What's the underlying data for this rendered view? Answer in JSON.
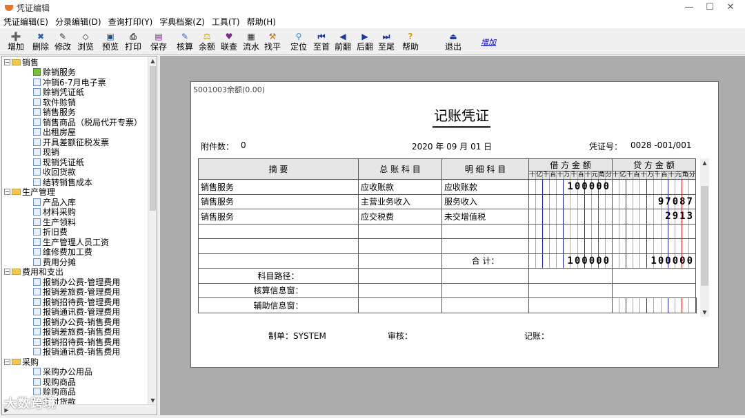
{
  "window": {
    "title": "凭证编辑",
    "controls": [
      "—",
      "☐",
      "✕"
    ]
  },
  "menu": [
    "凭证编辑(E)",
    "分录编辑(D)",
    "查询打印(Y)",
    "字典档案(Z)",
    "工具(T)",
    "帮助(H)"
  ],
  "toolbar": [
    {
      "label": "增加",
      "icon": "add-icon",
      "glyph": "➕",
      "color": "#2a5db0"
    },
    {
      "label": "删除",
      "icon": "delete-icon",
      "glyph": "✖",
      "color": "#2a5db0"
    },
    {
      "label": "修改",
      "icon": "edit-icon",
      "glyph": "✎",
      "color": "#333"
    },
    {
      "label": "浏览",
      "icon": "browse-icon",
      "glyph": "◇",
      "color": "#333"
    },
    {
      "label": "预览",
      "icon": "preview-icon",
      "glyph": "▣",
      "color": "#225588"
    },
    {
      "label": "打印",
      "icon": "print-icon",
      "glyph": "⎙",
      "color": "#333"
    },
    {
      "label": "保存",
      "icon": "save-icon",
      "glyph": "▤",
      "color": "#7a2a8a"
    },
    {
      "label": "核算",
      "icon": "calc-icon",
      "glyph": "✎",
      "color": "#3366cc"
    },
    {
      "label": "余额",
      "icon": "balance-icon",
      "glyph": "⚖",
      "color": "#c0a000"
    },
    {
      "label": "联查",
      "icon": "linked-query-icon",
      "glyph": "♥",
      "color": "#7a2a8a"
    },
    {
      "label": "流水",
      "icon": "journal-icon",
      "glyph": "▦",
      "color": "#333"
    },
    {
      "label": "找平",
      "icon": "level-icon",
      "glyph": "⚒",
      "color": "#c07000"
    },
    {
      "label": "定位",
      "icon": "locate-icon",
      "glyph": "⚲",
      "color": "#3388cc"
    },
    {
      "label": "至首",
      "icon": "first-icon",
      "glyph": "⏮",
      "color": "#1a3aa0"
    },
    {
      "label": "前翻",
      "icon": "prev-icon",
      "glyph": "◀",
      "color": "#1a3aa0"
    },
    {
      "label": "后翻",
      "icon": "next-icon",
      "glyph": "▶",
      "color": "#1a3aa0"
    },
    {
      "label": "至尾",
      "icon": "last-icon",
      "glyph": "⏭",
      "color": "#1a3aa0"
    },
    {
      "label": "帮助",
      "icon": "help-icon",
      "glyph": "?",
      "color": "#d4a000"
    },
    {
      "label": "退出",
      "icon": "exit-icon",
      "glyph": "⏏",
      "color": "#1a3aa0"
    }
  ],
  "toolbar_link": "增加",
  "tree": [
    {
      "level": 0,
      "type": "folder",
      "label": "销售"
    },
    {
      "level": 1,
      "type": "leaf",
      "label": "赊销服务",
      "selected": true
    },
    {
      "level": 1,
      "type": "leaf",
      "label": "冲销6-7月电子票"
    },
    {
      "level": 1,
      "type": "leaf",
      "label": "赊销凭证纸"
    },
    {
      "level": 1,
      "type": "leaf",
      "label": "软件赊销"
    },
    {
      "level": 1,
      "type": "leaf",
      "label": "销售服务"
    },
    {
      "level": 1,
      "type": "leaf",
      "label": "销售商品（税局代开专票）"
    },
    {
      "level": 1,
      "type": "leaf",
      "label": "出租房屋"
    },
    {
      "level": 1,
      "type": "leaf",
      "label": "开具差额征税发票"
    },
    {
      "level": 1,
      "type": "leaf",
      "label": "现销"
    },
    {
      "level": 1,
      "type": "leaf",
      "label": "现销凭证纸"
    },
    {
      "level": 1,
      "type": "leaf",
      "label": "收回货款"
    },
    {
      "level": 1,
      "type": "leaf",
      "label": "结转销售成本"
    },
    {
      "level": 0,
      "type": "folder",
      "label": "生产管理"
    },
    {
      "level": 1,
      "type": "leaf",
      "label": "产品入库"
    },
    {
      "level": 1,
      "type": "leaf",
      "label": "材料采购"
    },
    {
      "level": 1,
      "type": "leaf",
      "label": "生产领料"
    },
    {
      "level": 1,
      "type": "leaf",
      "label": "折旧费"
    },
    {
      "level": 1,
      "type": "leaf",
      "label": "生产管理人员工资"
    },
    {
      "level": 1,
      "type": "leaf",
      "label": "维修费加工费"
    },
    {
      "level": 1,
      "type": "leaf",
      "label": "费用分摊"
    },
    {
      "level": 0,
      "type": "folder",
      "label": "费用和支出"
    },
    {
      "level": 1,
      "type": "leaf",
      "label": "报销办公费-管理费用"
    },
    {
      "level": 1,
      "type": "leaf",
      "label": "报销差旅费-管理费用"
    },
    {
      "level": 1,
      "type": "leaf",
      "label": "报销招待费-管理费用"
    },
    {
      "level": 1,
      "type": "leaf",
      "label": "报销通讯费-管理费用"
    },
    {
      "level": 1,
      "type": "leaf",
      "label": "报销办公费-销售费用"
    },
    {
      "level": 1,
      "type": "leaf",
      "label": "报销差旅费-销售费用"
    },
    {
      "level": 1,
      "type": "leaf",
      "label": "报销招待费-销售费用"
    },
    {
      "level": 1,
      "type": "leaf",
      "label": "报销通讯费-销售费用"
    },
    {
      "level": 0,
      "type": "folder",
      "label": "采购"
    },
    {
      "level": 1,
      "type": "leaf",
      "label": "采购办公用品"
    },
    {
      "level": 1,
      "type": "leaf",
      "label": "现购商品"
    },
    {
      "level": 1,
      "type": "leaf",
      "label": "赊购商品"
    },
    {
      "level": 1,
      "type": "leaf",
      "label": "支付货款"
    }
  ],
  "watermark": "大数跨境",
  "voucher": {
    "balance_note": "5001003余额(0.00)",
    "title": "记账凭证",
    "attach_label": "附件数：",
    "attach_value": "0",
    "date": "2020  年 09 月 01 日",
    "no_label": "凭证号：",
    "no_value": "0028 -001/001",
    "headers": {
      "summary": "摘      要",
      "account": "总 账 科 目",
      "detail": "明 细 科 目",
      "debit": "借 方 金 额",
      "credit": "贷 方 金 额"
    },
    "digit_units": [
      "十",
      "亿",
      "千",
      "百",
      "十",
      "万",
      "千",
      "百",
      "十",
      "元",
      "角",
      "分"
    ],
    "rows": [
      {
        "summary": "销售服务",
        "account": "应收账款",
        "detail": "应收账款",
        "debit": "100000",
        "credit": ""
      },
      {
        "summary": "销售服务",
        "account": "主营业务收入",
        "detail": "服务收入",
        "debit": "",
        "credit": "97087"
      },
      {
        "summary": "销售服务",
        "account": "应交税费",
        "detail": "未交增值税",
        "debit": "",
        "credit": "2913"
      },
      {
        "summary": "",
        "account": "",
        "detail": "",
        "debit": "",
        "credit": ""
      },
      {
        "summary": "",
        "account": "",
        "detail": "",
        "debit": "",
        "credit": ""
      }
    ],
    "total_label": "合    计：",
    "total_debit": "100000",
    "total_credit": "100000",
    "info_rows": [
      "科目路径：",
      "核算信息窗：",
      "辅助信息窗："
    ],
    "maker": "制单：SYSTEM",
    "auditor": "审核：",
    "bookkeeper": "记账："
  }
}
